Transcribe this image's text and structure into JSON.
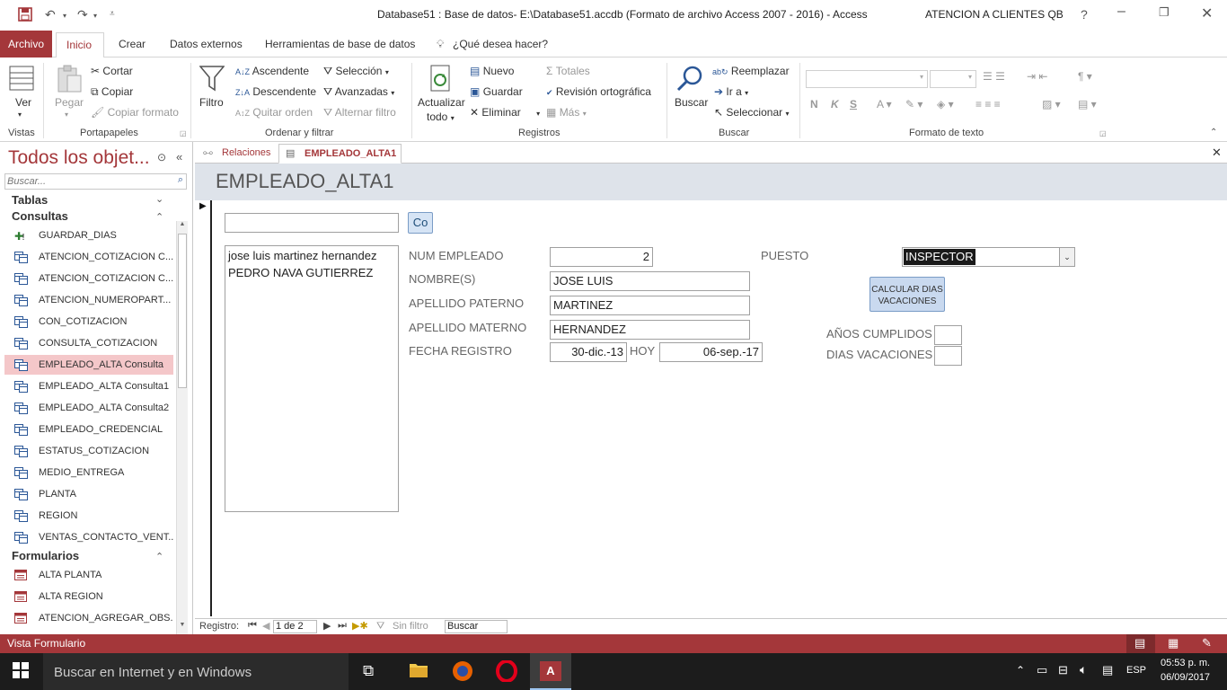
{
  "window": {
    "title": "Database51 : Base de datos- E:\\Database51.accdb (Formato de archivo Access 2007 - 2016)  -  Access",
    "user": "ATENCION A CLIENTES QB",
    "help": "?"
  },
  "menu": {
    "tabs": [
      "Archivo",
      "Inicio",
      "Crear",
      "Datos externos",
      "Herramientas de base de datos"
    ],
    "tell_me": "¿Qué desea hacer?"
  },
  "ribbon": {
    "vistas": {
      "label": "Vistas",
      "ver": "Ver"
    },
    "portapapeles": {
      "label": "Portapapeles",
      "pegar": "Pegar",
      "cortar": "Cortar",
      "copiar": "Copiar",
      "copiar_formato": "Copiar formato"
    },
    "ordenar": {
      "label": "Ordenar y filtrar",
      "filtro": "Filtro",
      "ascendente": "Ascendente",
      "descendente": "Descendente",
      "quitar_orden": "Quitar orden",
      "seleccion": "Selección",
      "avanzadas": "Avanzadas",
      "alternar": "Alternar filtro"
    },
    "registros": {
      "label": "Registros",
      "actualizar": "Actualizar",
      "todo": "todo",
      "nuevo": "Nuevo",
      "guardar": "Guardar",
      "eliminar": "Eliminar",
      "totales": "Totales",
      "revision": "Revisión ortográfica",
      "mas": "Más"
    },
    "buscar": {
      "label": "Buscar",
      "buscar": "Buscar",
      "reemplazar": "Reemplazar",
      "ir_a": "Ir a",
      "seleccionar": "Seleccionar"
    },
    "formato": {
      "label": "Formato de texto",
      "n": "N",
      "k": "K",
      "s": "S"
    }
  },
  "nav": {
    "title": "Todos los objet...",
    "search_placeholder": "Buscar...",
    "cat_tablas": "Tablas",
    "cat_consultas": "Consultas",
    "consultas": [
      "GUARDAR_DIAS",
      "ATENCION_COTIZACION C...",
      "ATENCION_COTIZACION C...",
      "ATENCION_NUMEROPART...",
      "CON_COTIZACION",
      "CONSULTA_COTIZACION",
      "EMPLEADO_ALTA Consulta",
      "EMPLEADO_ALTA Consulta1",
      "EMPLEADO_ALTA Consulta2",
      "EMPLEADO_CREDENCIAL",
      "ESTATUS_COTIZACION",
      "MEDIO_ENTREGA",
      "PLANTA",
      "REGION",
      "VENTAS_CONTACTO_VENT..."
    ],
    "cat_formularios": "Formularios",
    "formularios": [
      "ALTA PLANTA",
      "ALTA REGION",
      "ATENCION_AGREGAR_OBS..."
    ]
  },
  "doc_tabs": [
    "Relaciones",
    "EMPLEADO_ALTA1"
  ],
  "form": {
    "title": "EMPLEADO_ALTA1",
    "search_value": "",
    "co_button": "Co",
    "list_items": [
      "jose luis martinez hernandez",
      "PEDRO NAVA GUTIERREZ"
    ],
    "labels": {
      "num": "NUM EMPLEADO",
      "nombre": "NOMBRE(S)",
      "paterno": "APELLIDO PATERNO",
      "materno": "APELLIDO MATERNO",
      "fecha": "FECHA REGISTRO",
      "hoy": "HOY",
      "puesto": "PUESTO",
      "anios": "AÑOS CUMPLIDOS",
      "dias": "DIAS VACACIONES"
    },
    "values": {
      "num": "2",
      "nombre": "JOSE LUIS",
      "paterno": "MARTINEZ",
      "materno": "HERNANDEZ",
      "fecha": "30-dic.-13",
      "hoy": "06-sep.-17",
      "puesto": "INSPECTOR",
      "anios": "",
      "dias": ""
    },
    "calc_button_line1": "CALCULAR DIAS",
    "calc_button_line2": "VACACIONES"
  },
  "record_nav": {
    "label": "Registro:",
    "position": "1 de 2",
    "filter": "Sin filtro",
    "search": "Buscar"
  },
  "status": {
    "text": "Vista Formulario"
  },
  "taskbar": {
    "search": "Buscar en Internet y en Windows",
    "lang": "ESP",
    "time": "05:53 p. m.",
    "date": "06/09/2017"
  },
  "colors": {
    "accent": "#a4373a",
    "selected": "#f4c7c9",
    "header": "#dee3ea"
  }
}
